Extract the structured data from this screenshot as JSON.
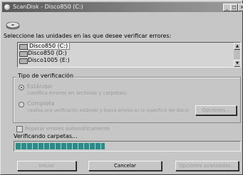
{
  "window": {
    "title": "ScanDisk - Disco850 (C:)"
  },
  "titlebar_buttons": {
    "minimize": "_",
    "maximize": "□",
    "close": "×"
  },
  "prompt": "Seleccione las unidades en las que desee verificar errores:",
  "drives": [
    {
      "label": "Disco850 (C:)",
      "selected": true
    },
    {
      "label": "Disco850 (D:)",
      "selected": false
    },
    {
      "label": "Disco1005 (E:)",
      "selected": false
    }
  ],
  "verification": {
    "group_title": "Tipo de verificación",
    "standard": {
      "label": "Estándar",
      "description": "(verifica errores en archivos y carpetas)",
      "checked": true
    },
    "thorough": {
      "label": "Completa",
      "description": "(realiza una verificación estándar y busca errores en la superficie del disco)",
      "checked": false
    },
    "options_button": "Opciones..."
  },
  "auto_fix": {
    "label": "Reparar errores automáticamente",
    "checked": true
  },
  "status": "Verificando carpetas...",
  "progress": {
    "fraction": 0.4
  },
  "buttons": {
    "start": "Iniciar",
    "cancel": "Cancelar",
    "advanced": "Opciones avanzadas..."
  }
}
